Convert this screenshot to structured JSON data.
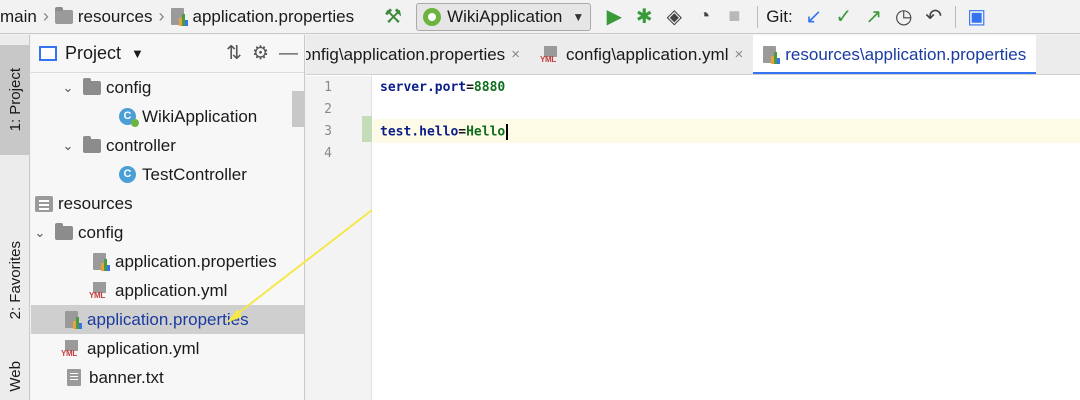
{
  "breadcrumb": {
    "items": [
      "main",
      "resources",
      "application.properties"
    ]
  },
  "toolbar": {
    "run_config": "WikiApplication",
    "git_label": "Git:"
  },
  "side_tabs": {
    "project": "1: Project",
    "favorites": "2: Favorites",
    "web": "Web"
  },
  "project_panel": {
    "title": "Project"
  },
  "tree": [
    {
      "label": "config",
      "type": "folder",
      "expanded": true
    },
    {
      "label": "WikiApplication",
      "type": "spring-class"
    },
    {
      "label": "controller",
      "type": "folder",
      "expanded": true
    },
    {
      "label": "TestController",
      "type": "class"
    },
    {
      "label": "resources",
      "type": "resources-folder"
    },
    {
      "label": "config",
      "type": "folder",
      "expanded": true
    },
    {
      "label": "application.properties",
      "type": "properties"
    },
    {
      "label": "application.yml",
      "type": "yml"
    },
    {
      "label": "application.properties",
      "type": "properties",
      "selected": true
    },
    {
      "label": "application.yml",
      "type": "yml"
    },
    {
      "label": "banner.txt",
      "type": "txt"
    }
  ],
  "editor_tabs": [
    {
      "label": "onfig\\application.properties",
      "close": "×"
    },
    {
      "label": "config\\application.yml",
      "close": "×"
    },
    {
      "label": "resources\\application.properties",
      "active": true
    }
  ],
  "code": {
    "line_numbers": [
      "1",
      "2",
      "3",
      "4"
    ],
    "lines": [
      {
        "key": "server.port",
        "eq": "=",
        "value": "8880"
      },
      {
        "key": "",
        "eq": "",
        "value": ""
      },
      {
        "key": "test.hello",
        "eq": "=",
        "value": "Hello"
      },
      {
        "key": "",
        "eq": "",
        "value": ""
      }
    ]
  },
  "colors": {
    "accent": "#3574f0",
    "annotation_arrow": "#f5e84a"
  }
}
